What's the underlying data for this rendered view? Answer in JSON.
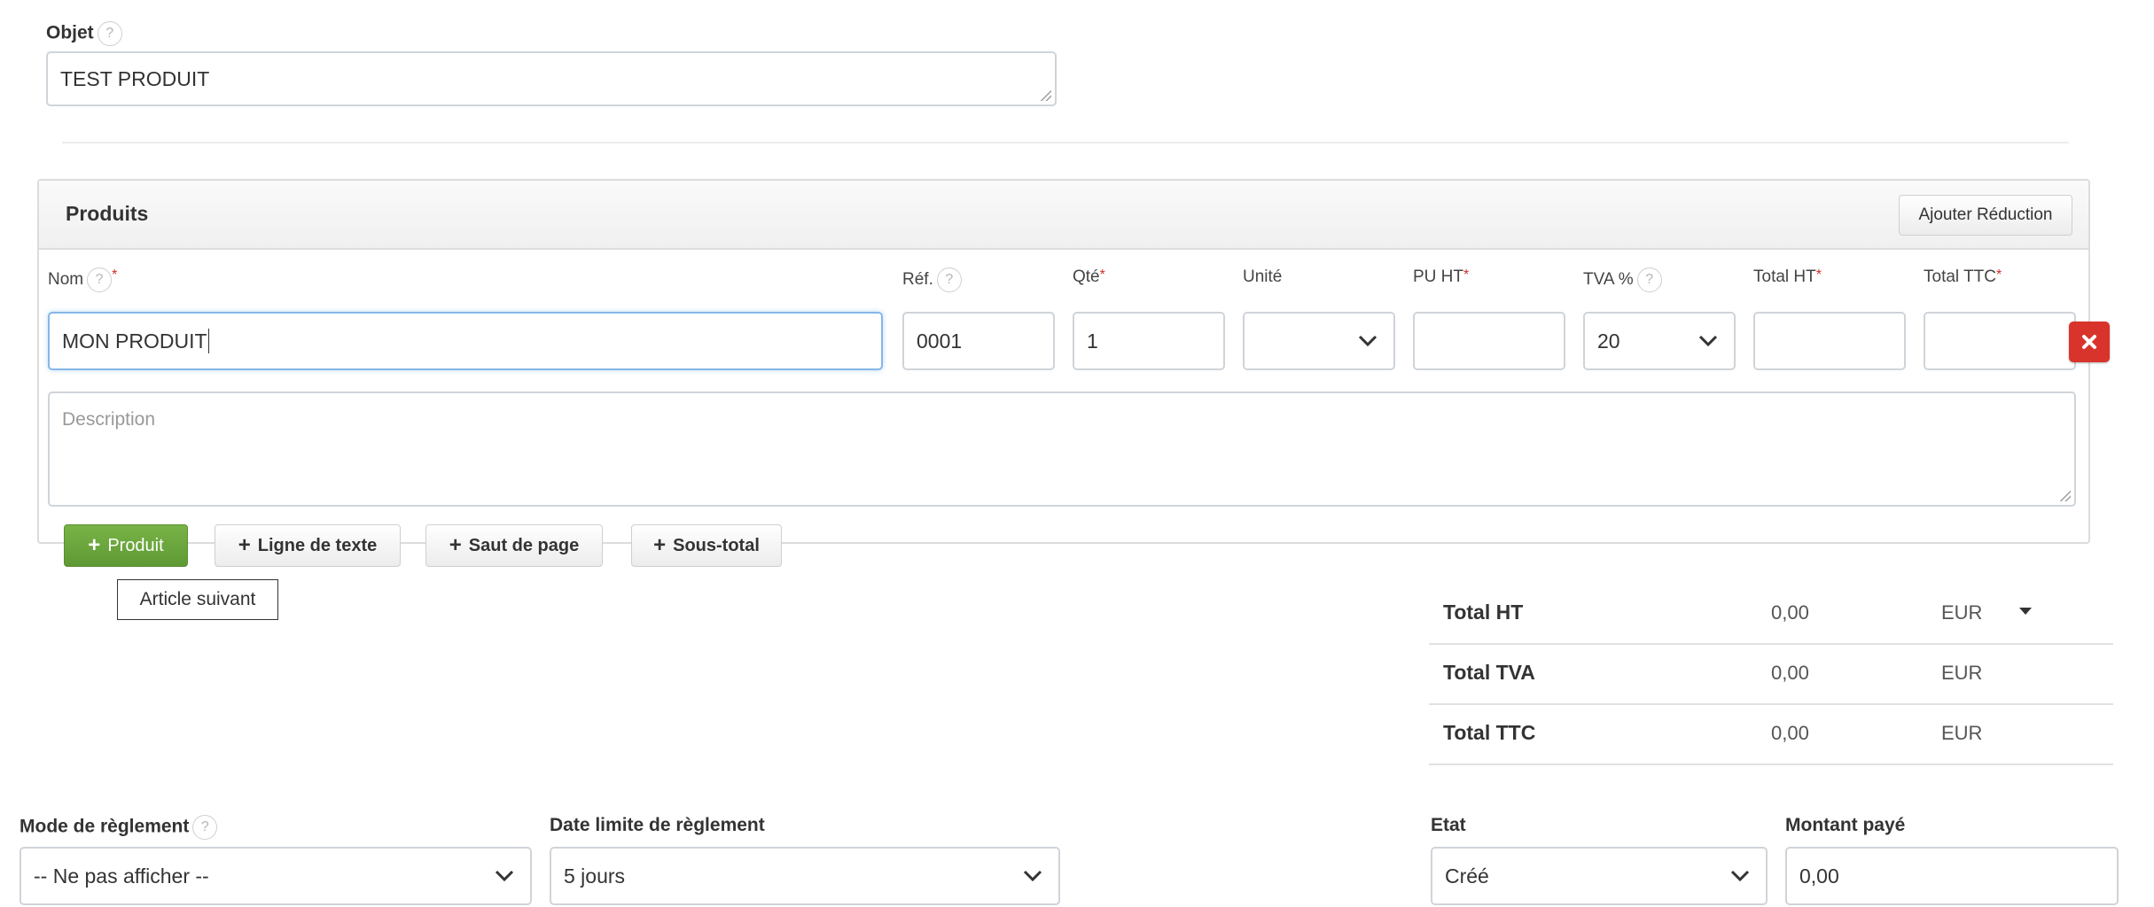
{
  "objet": {
    "label": "Objet",
    "value": "TEST PRODUIT"
  },
  "produits": {
    "title": "Produits",
    "ajouter_reduction": "Ajouter Réduction",
    "columns": {
      "nom": "Nom",
      "ref": "Réf.",
      "qte": "Qté",
      "unite": "Unité",
      "pu_ht": "PU HT",
      "tva": "TVA %",
      "total_ht": "Total HT",
      "total_ttc": "Total TTC"
    },
    "required_mark": "*",
    "row": {
      "nom": "MON PRODUIT",
      "ref": "0001",
      "qte": "1",
      "unite": "",
      "pu_ht": "",
      "tva": "20",
      "total_ht": "",
      "total_ttc": ""
    },
    "description_placeholder": "Description",
    "buttons": {
      "produit": "Produit",
      "ligne_texte": "Ligne de texte",
      "saut_page": "Saut de page",
      "sous_total": "Sous-total"
    },
    "tooltip": "Article suivant"
  },
  "totals": {
    "currency": "EUR",
    "rows": [
      {
        "label": "Total HT",
        "value": "0,00",
        "currency": "EUR"
      },
      {
        "label": "Total TVA",
        "value": "0,00",
        "currency": "EUR"
      },
      {
        "label": "Total TTC",
        "value": "0,00",
        "currency": "EUR"
      }
    ]
  },
  "footer": {
    "mode_reglement": {
      "label": "Mode de règlement",
      "value": "-- Ne pas afficher --"
    },
    "date_limite": {
      "label": "Date limite de règlement",
      "value": "5 jours"
    },
    "etat": {
      "label": "Etat",
      "value": "Créé"
    },
    "montant_paye": {
      "label": "Montant payé",
      "value": "0,00"
    }
  },
  "icons": {
    "help": "question-circle-icon",
    "chevron": "chevron-down-icon",
    "delete": "delete-x-icon",
    "plus": "plus-icon",
    "caret": "caret-down-icon"
  },
  "colors": {
    "delete_red": "#d9342b",
    "produit_green": "#6aa33c",
    "focus_blue": "#86b7e8"
  }
}
